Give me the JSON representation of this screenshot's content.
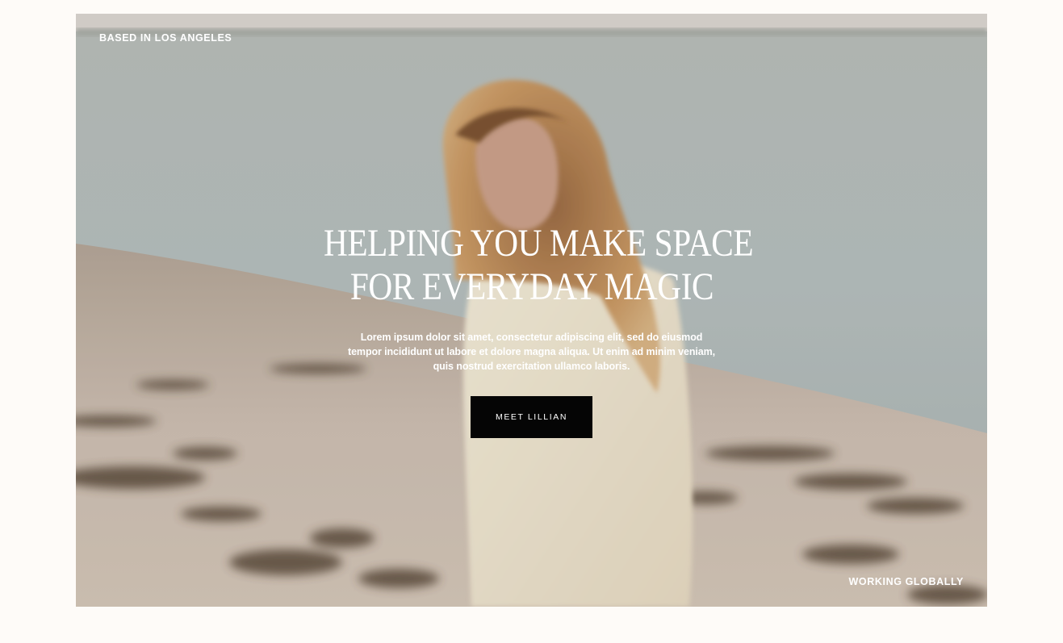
{
  "hero": {
    "top_left_label": "BASED IN LOS ANGELES",
    "bottom_right_label": "WORKING GLOBALLY",
    "headline_line1": "HELPING YOU MAKE SPACE",
    "headline_line2": "FOR EVERYDAY MAGIC",
    "body": "Lorem ipsum dolor sit amet, consectetur adipiscing elit, sed do eiusmod tempor incididunt ut labore et dolore magna aliqua. Ut enim ad minim veniam, quis nostrud exercitation ullamco laboris.",
    "cta_label": "MEET LILLIAN"
  },
  "colors": {
    "page_background": "#fefbf8",
    "cta_background": "#050505",
    "text_on_photo": "#ffffff"
  }
}
